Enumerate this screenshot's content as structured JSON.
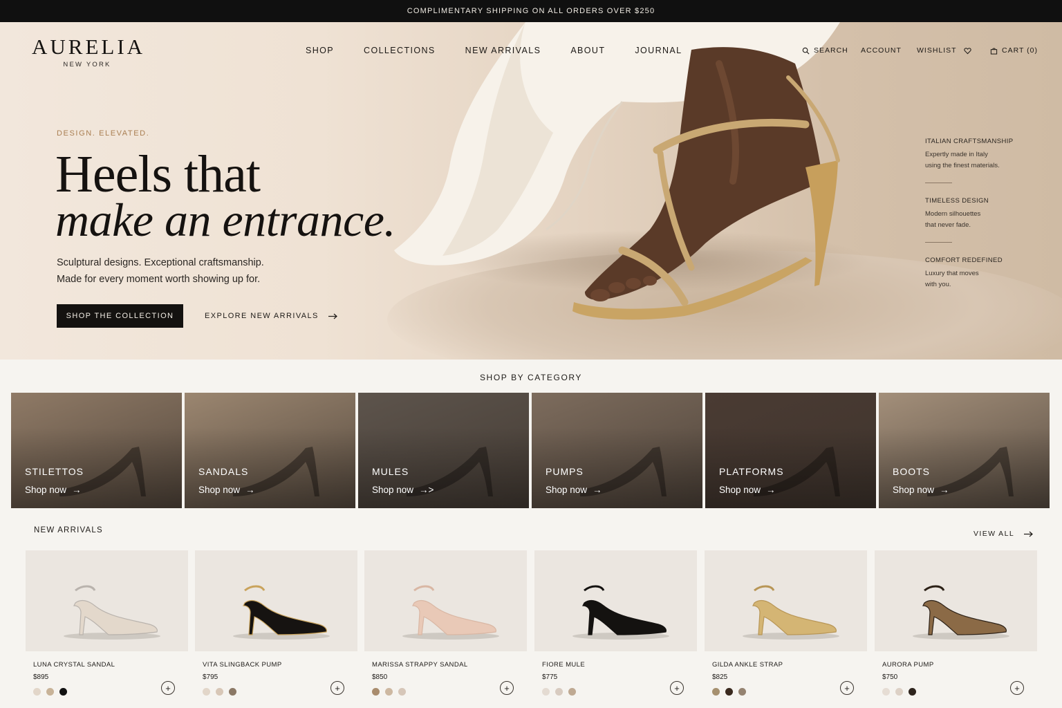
{
  "announcement": "COMPLIMENTARY SHIPPING ON ALL ORDERS OVER $250",
  "brand": {
    "name": "AURELIA",
    "tagline": "NEW YORK"
  },
  "nav": {
    "links": [
      "SHOP",
      "COLLECTIONS",
      "NEW ARRIVALS",
      "ABOUT",
      "JOURNAL"
    ],
    "search": "SEARCH",
    "account": "ACCOUNT",
    "wishlist": "WISHLIST",
    "cart": "CART (0)"
  },
  "hero": {
    "eyebrow": "DESIGN. ELEVATED.",
    "headline_line1": "Heels that",
    "headline_line2": "make an entrance.",
    "subtext_line1": "Sculptural designs. Exceptional craftsmanship.",
    "subtext_line2": "Made for every moment worth showing up for.",
    "primary_cta": "SHOP THE COLLECTION",
    "secondary_cta": "EXPLORE NEW ARRIVALS",
    "features": [
      {
        "title": "ITALIAN CRAFTSMANSHIP",
        "line1": "Expertly made in Italy",
        "line2": "using the finest materials."
      },
      {
        "title": "TIMELESS DESIGN",
        "line1": "Modern silhouettes",
        "line2": "that never fade."
      },
      {
        "title": "COMFORT REDEFINED",
        "line1": "Luxury that moves",
        "line2": "with you."
      }
    ]
  },
  "categories": {
    "title": "SHOP BY CATEGORY",
    "items": [
      {
        "name": "STILETTOS",
        "cta": "Shop now",
        "arrow": "→"
      },
      {
        "name": "SANDALS",
        "cta": "Shop now",
        "arrow": "→"
      },
      {
        "name": "MULES",
        "cta": "Shop now",
        "arrow": "→>"
      },
      {
        "name": "PUMPS",
        "cta": "Shop now",
        "arrow": "→"
      },
      {
        "name": "PLATFORMS",
        "cta": "Shop now",
        "arrow": "→"
      },
      {
        "name": "BOOTS",
        "cta": "Shop now",
        "arrow": "→"
      }
    ],
    "colors": [
      "#8f7a66",
      "#9b8670",
      "#5d544c",
      "#7d6c5d",
      "#4a3b33",
      "#a38f7a"
    ]
  },
  "new_arrivals": {
    "title": "NEW ARRIVALS",
    "view_all": "VIEW ALL",
    "products": [
      {
        "name": "LUNA CRYSTAL SANDAL",
        "price": "$895",
        "shoe_color": "#e3d8cb",
        "accent": "#b9b3ad",
        "swatches": [
          "#e2d6c9",
          "#c8b398",
          "#111111"
        ]
      },
      {
        "name": "VITA SLINGBACK PUMP",
        "price": "$795",
        "shoe_color": "#161311",
        "accent": "#c9a35c",
        "swatches": [
          "#e2d6c9",
          "#d8c7b7",
          "#8b7865"
        ]
      },
      {
        "name": "MARISSA STRAPPY SANDAL",
        "price": "$850",
        "shoe_color": "#e9c9b7",
        "accent": "#d9b7a4",
        "swatches": [
          "#a98c6d",
          "#cdb8a1",
          "#d6c6b8"
        ]
      },
      {
        "name": "FIORE MULE",
        "price": "$775",
        "shoe_color": "#141210",
        "accent": "#141210",
        "swatches": [
          "#e4dbd2",
          "#d8cbc0",
          "#bfa992"
        ]
      },
      {
        "name": "GILDA ANKLE STRAP",
        "price": "$825",
        "shoe_color": "#d4b574",
        "accent": "#b89656",
        "swatches": [
          "#a6906f",
          "#3a2a1f",
          "#958371"
        ]
      },
      {
        "name": "AURORA PUMP",
        "price": "$750",
        "shoe_color": "#8b6a46",
        "accent": "#2c2117",
        "swatches": [
          "#e6ddd4",
          "#ddd1c6",
          "#2e241d"
        ]
      }
    ]
  },
  "icons": {
    "search": "search-icon",
    "wishlist": "heart-icon",
    "cart": "bag-icon",
    "add": "plus-icon",
    "arrow": "arrow-right-icon"
  },
  "accent_color": "#a97e51"
}
